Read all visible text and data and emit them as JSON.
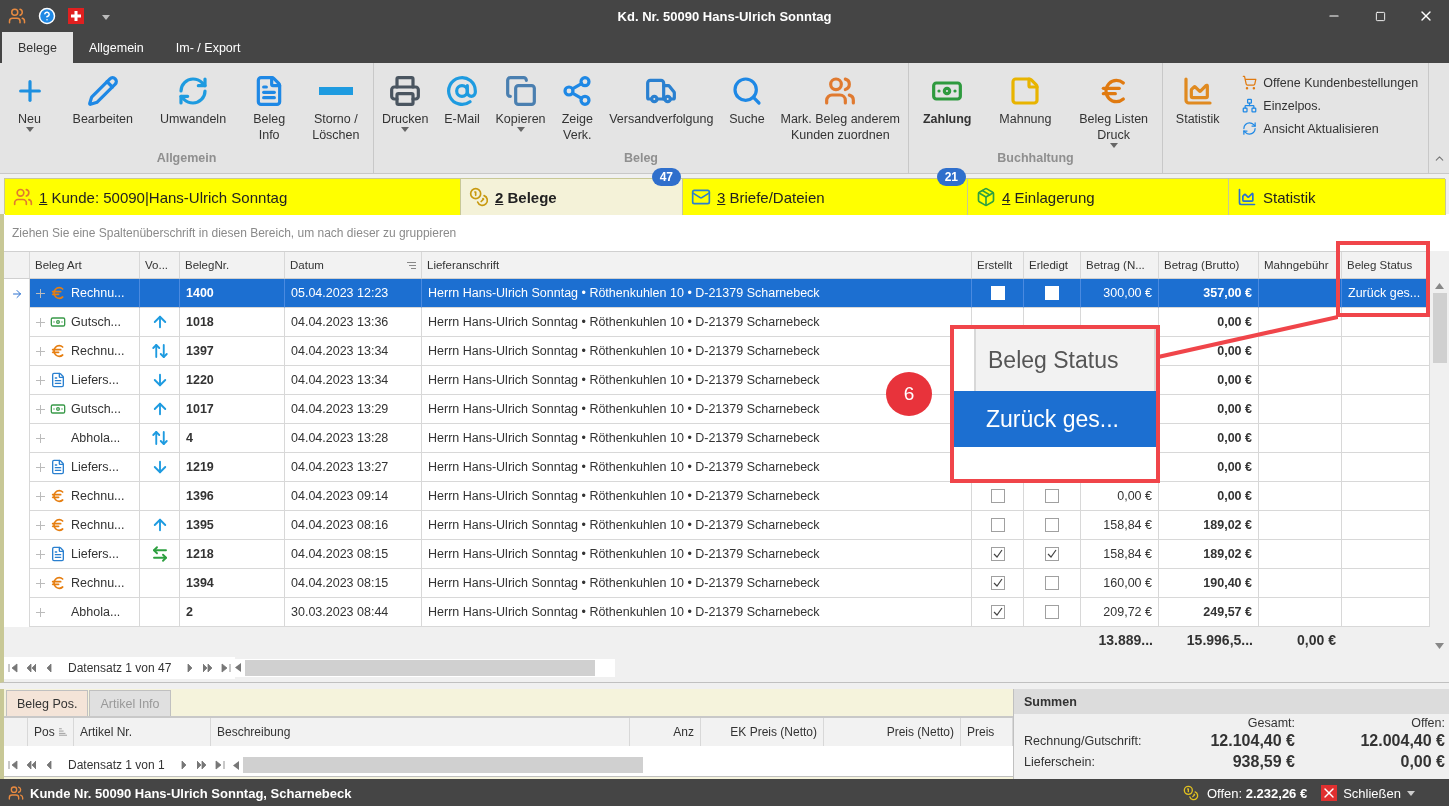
{
  "window": {
    "title": "Kd. Nr. 50090 Hans-Ulrich Sonntag"
  },
  "ribbon": {
    "tabs": [
      {
        "label": "Belege",
        "selected": true
      },
      {
        "label": "Allgemein",
        "selected": false
      },
      {
        "label": "Im- / Export",
        "selected": false
      }
    ],
    "groups": [
      {
        "label": "Allgemein",
        "buttons": [
          {
            "label": "Neu",
            "dropdown": true,
            "bold": false
          },
          {
            "label": "Bearbeiten",
            "dropdown": false,
            "bold": false
          },
          {
            "label": "Umwandeln",
            "dropdown": false,
            "bold": false
          },
          {
            "label": "Beleg\nInfo",
            "dropdown": false,
            "bold": false
          },
          {
            "label": "Storno /\nLöschen",
            "dropdown": false,
            "bold": false
          }
        ]
      },
      {
        "label": "Beleg",
        "buttons": [
          {
            "label": "Drucken",
            "dropdown": true,
            "bold": false
          },
          {
            "label": "E-Mail",
            "dropdown": false,
            "bold": false
          },
          {
            "label": "Kopieren",
            "dropdown": true,
            "bold": false
          },
          {
            "label": "Zeige\nVerk.",
            "dropdown": false,
            "bold": false
          },
          {
            "label": "Versandverfolgung",
            "dropdown": false,
            "bold": false
          },
          {
            "label": "Suche",
            "dropdown": false,
            "bold": false
          },
          {
            "label": "Mark. Beleg  anderem\nKunden zuordnen",
            "dropdown": false,
            "bold": false
          }
        ]
      },
      {
        "label": "Buchhaltung",
        "buttons": [
          {
            "label": "Zahlung",
            "dropdown": false,
            "bold": true
          },
          {
            "label": "Mahnung",
            "dropdown": false,
            "bold": false
          },
          {
            "label": "Beleg Listen\nDruck",
            "dropdown": true,
            "bold": false
          }
        ]
      },
      {
        "buttons": [
          {
            "label": "Statistik",
            "dropdown": false,
            "bold": false
          }
        ],
        "small_items": [
          "Offene Kundenbestellungen",
          "Einzelpos.",
          "Ansicht Aktualisieren"
        ]
      }
    ]
  },
  "doc_tabs": [
    {
      "key": "1",
      "label": "Kunde: 50090|Hans-Ulrich Sonntag",
      "selected": false
    },
    {
      "key": "2",
      "label": "Belege",
      "selected": true,
      "badge": "47"
    },
    {
      "key": "3",
      "label": "Briefe/Dateien",
      "selected": false,
      "badge": "21"
    },
    {
      "key": "4",
      "label": "Einlagerung",
      "selected": false
    },
    {
      "label": "Statistik",
      "selected": false
    }
  ],
  "group_hint": "Ziehen Sie eine Spaltenüberschrift in diesen Bereich, um nach dieser zu gruppieren",
  "table": {
    "columns": [
      "Beleg Art",
      "Vo...",
      "BelegNr.",
      "Datum",
      "Lieferanschrift",
      "Erstellt",
      "Erledigt",
      "Betrag (N...",
      "Betrag (Brutto)",
      "Mahngebühr",
      "Beleg Status"
    ],
    "rows": [
      {
        "selected": true,
        "icon": {
          "kind": "invoice"
        },
        "art": "Rechnu...",
        "nr": "1400",
        "datum": "05.04.2023 12:23",
        "adresse": "Herrn Hans-Ulrich Sonntag • Röthenkuhlen 10 • D-21379 Scharnebeck",
        "erstellt": false,
        "erledigt": false,
        "netto": "300,00 €",
        "brutto": "357,00 €",
        "status": "Zurück ges..."
      },
      {
        "selected": false,
        "icon": {
          "kind": "credit"
        },
        "art": "Gutsch...",
        "direction": {
          "kind": "up"
        },
        "nr": "1018",
        "datum": "04.04.2023 13:36",
        "adresse": "Herrn Hans-Ulrich Sonntag • Röthenkuhlen 10 • D-21379 Scharnebeck",
        "brutto": "0,00 €"
      },
      {
        "selected": false,
        "icon": {
          "kind": "invoice"
        },
        "art": "Rechnu...",
        "direction": {
          "kind": "updown"
        },
        "nr": "1397",
        "datum": "04.04.2023 13:34",
        "adresse": "Herrn Hans-Ulrich Sonntag • Röthenkuhlen 10 • D-21379 Scharnebeck",
        "brutto": "0,00 €"
      },
      {
        "selected": false,
        "icon": {
          "kind": "delivery"
        },
        "art": "Liefers...",
        "direction": {
          "kind": "down"
        },
        "nr": "1220",
        "datum": "04.04.2023 13:34",
        "adresse": "Herrn Hans-Ulrich Sonntag • Röthenkuhlen 10 • D-21379 Scharnebeck",
        "brutto": "0,00 €"
      },
      {
        "selected": false,
        "icon": {
          "kind": "credit"
        },
        "art": "Gutsch...",
        "direction": {
          "kind": "up"
        },
        "nr": "1017",
        "datum": "04.04.2023 13:29",
        "adresse": "Herrn Hans-Ulrich Sonntag • Röthenkuhlen 10 • D-21379 Scharnebeck",
        "brutto": "0,00 €"
      },
      {
        "selected": false,
        "art": "Abhola...",
        "direction": {
          "kind": "updown"
        },
        "nr": "4",
        "datum": "04.04.2023 13:28",
        "adresse": "Herrn Hans-Ulrich Sonntag • Röthenkuhlen 10 • D-21379 Scharnebeck",
        "brutto": "0,00 €"
      },
      {
        "selected": false,
        "icon": {
          "kind": "delivery"
        },
        "art": "Liefers...",
        "direction": {
          "kind": "down"
        },
        "nr": "1219",
        "datum": "04.04.2023 13:27",
        "adresse": "Herrn Hans-Ulrich Sonntag • Röthenkuhlen 10 • D-21379 Scharnebeck",
        "brutto": "0,00 €"
      },
      {
        "selected": false,
        "icon": {
          "kind": "invoice"
        },
        "art": "Rechnu...",
        "nr": "1396",
        "datum": "04.04.2023 09:14",
        "adresse": "Herrn Hans-Ulrich Sonntag • Röthenkuhlen 10 • D-21379 Scharnebeck",
        "erstellt": false,
        "erledigt": false,
        "netto": "0,00 €",
        "brutto": "0,00 €"
      },
      {
        "selected": false,
        "icon": {
          "kind": "invoice"
        },
        "art": "Rechnu...",
        "direction": {
          "kind": "up"
        },
        "nr": "1395",
        "datum": "04.04.2023 08:16",
        "adresse": "Herrn Hans-Ulrich Sonntag • Röthenkuhlen 10 • D-21379 Scharnebeck",
        "erstellt": false,
        "erledigt": false,
        "netto": "158,84 €",
        "brutto": "189,02 €"
      },
      {
        "selected": false,
        "icon": {
          "kind": "delivery"
        },
        "art": "Liefers...",
        "direction": {
          "kind": "transfer"
        },
        "nr": "1218",
        "datum": "04.04.2023 08:15",
        "adresse": "Herrn Hans-Ulrich Sonntag • Röthenkuhlen 10 • D-21379 Scharnebeck",
        "erstellt": true,
        "erledigt": true,
        "netto": "158,84 €",
        "brutto": "189,02 €"
      },
      {
        "selected": false,
        "icon": {
          "kind": "invoice"
        },
        "art": "Rechnu...",
        "nr": "1394",
        "datum": "04.04.2023 08:15",
        "adresse": "Herrn Hans-Ulrich Sonntag • Röthenkuhlen 10 • D-21379 Scharnebeck",
        "erstellt": true,
        "erledigt": false,
        "netto": "160,00 €",
        "brutto": "190,40 €"
      },
      {
        "selected": false,
        "art": "Abhola...",
        "nr": "2",
        "datum": "30.03.2023 08:44",
        "adresse": "Herrn Hans-Ulrich Sonntag • Röthenkuhlen 10 • D-21379 Scharnebeck",
        "erstellt": true,
        "erledigt": false,
        "netto": "209,72 €",
        "brutto": "249,57 €"
      }
    ],
    "summary": {
      "netto": "13.889...",
      "brutto": "15.996,5...",
      "mahngebuehr": "0,00 €"
    },
    "navigator": "Datensatz 1 von 47"
  },
  "callout": {
    "badge": "6",
    "header": "Beleg Status",
    "value": "Zurück ges..."
  },
  "positions": {
    "tabs": [
      {
        "label": "Beleg Pos.",
        "selected": true
      },
      {
        "label": "Artikel Info",
        "selected": false
      }
    ],
    "columns": [
      "Pos",
      "Artikel Nr.",
      "Beschreibung",
      "Anz",
      "EK Preis (Netto)",
      "Preis (Netto)",
      "Preis"
    ],
    "navigator": "Datensatz 1 von 1"
  },
  "sums": {
    "title": "Summen",
    "headers": [
      "Gesamt:",
      "Offen:"
    ],
    "rows": [
      {
        "label": "Rechnung/Gutschrift:",
        "gesamt": "12.104,40 €",
        "offen": "12.004,40 €"
      },
      {
        "label": "Lieferschein:",
        "gesamt": "938,59 €",
        "offen": "0,00 €"
      }
    ]
  },
  "status_bar": {
    "customer": "Kunde Nr. 50090 Hans-Ulrich Sonntag, Scharnebeck",
    "open_label": "Offen:",
    "open_amount": "2.232,26 €",
    "close": "Schließen"
  }
}
